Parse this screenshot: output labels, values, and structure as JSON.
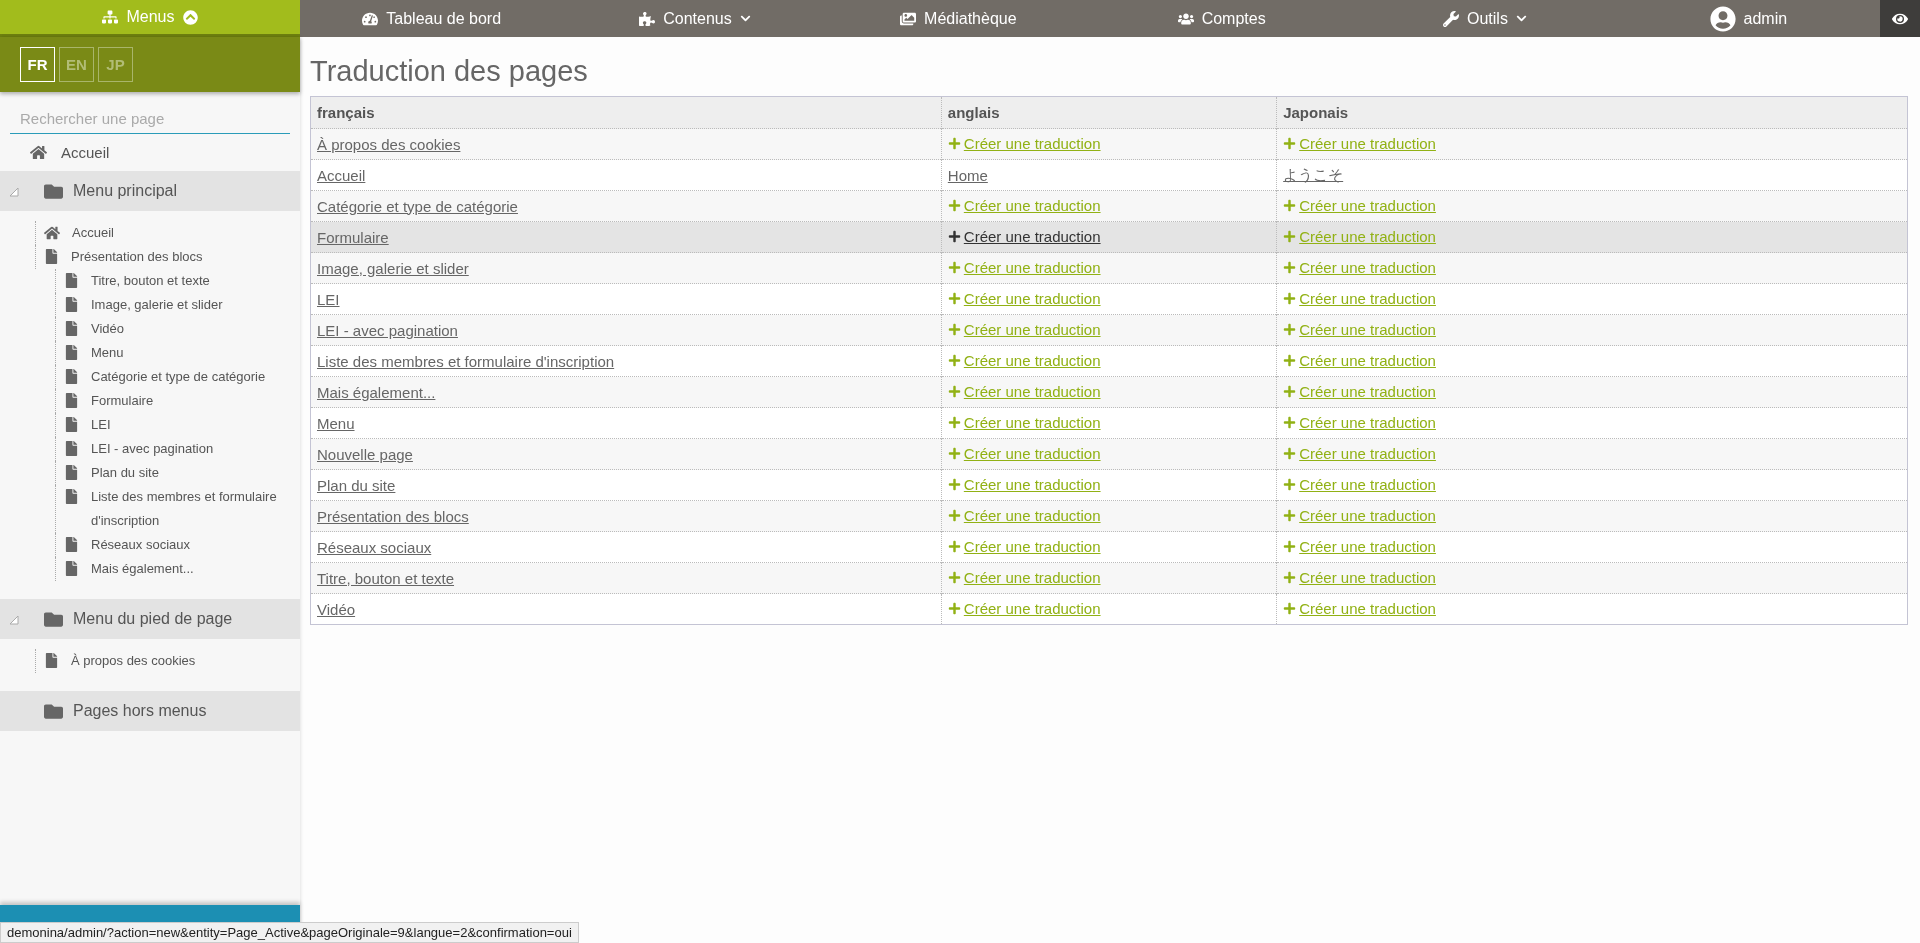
{
  "nav": {
    "items": [
      {
        "kind": "menus",
        "label": "Menus",
        "selected": true,
        "dropdown": true
      },
      {
        "kind": "dashboard",
        "label": "Tableau de bord",
        "selected": false,
        "dropdown": false
      },
      {
        "kind": "content",
        "label": "Contenus",
        "selected": false,
        "dropdown": true
      },
      {
        "kind": "media",
        "label": "Médiathèque",
        "selected": false,
        "dropdown": false
      },
      {
        "kind": "accounts",
        "label": "Comptes",
        "selected": false,
        "dropdown": false
      },
      {
        "kind": "tools",
        "label": "Outils",
        "selected": false,
        "dropdown": true
      },
      {
        "kind": "user",
        "label": "admin",
        "selected": false,
        "dropdown": false
      }
    ]
  },
  "sidebar": {
    "languages": [
      {
        "label": "FR",
        "selected": true
      },
      {
        "label": "EN",
        "selected": false
      },
      {
        "label": "JP",
        "selected": false
      }
    ],
    "search": {
      "placeholder": "Rechercher une page"
    },
    "home": {
      "label": "Accueil"
    },
    "groups": [
      {
        "label": "Menu principal",
        "expanded": true,
        "children": [
          {
            "kind": "home",
            "label": "Accueil"
          },
          {
            "kind": "page",
            "label": "Présentation des blocs",
            "children": [
              {
                "kind": "page",
                "label": "Titre, bouton et texte"
              },
              {
                "kind": "page",
                "label": "Image, galerie et slider"
              },
              {
                "kind": "page",
                "label": "Vidéo"
              },
              {
                "kind": "page",
                "label": "Menu"
              },
              {
                "kind": "page",
                "label": "Catégorie et type de catégorie"
              },
              {
                "kind": "page",
                "label": "Formulaire"
              },
              {
                "kind": "page",
                "label": "LEI"
              },
              {
                "kind": "page",
                "label": "LEI - avec pagination"
              },
              {
                "kind": "page",
                "label": "Plan du site"
              },
              {
                "kind": "page",
                "label": "Liste des membres et formulaire d'inscription"
              },
              {
                "kind": "page",
                "label": "Réseaux sociaux"
              },
              {
                "kind": "page",
                "label": "Mais également..."
              }
            ]
          }
        ]
      },
      {
        "label": "Menu du pied de page",
        "expanded": true,
        "children": [
          {
            "kind": "page",
            "label": "À propos des cookies"
          }
        ]
      },
      {
        "label": "Pages hors menus",
        "expanded": false
      }
    ]
  },
  "page": {
    "title": "Traduction des pages"
  },
  "table": {
    "columns": [
      "français",
      "anglais",
      "Japonais"
    ],
    "rows": [
      {
        "hovered": false,
        "cells": [
          {
            "kind": "link",
            "text": "À propos des cookies"
          },
          {
            "kind": "create",
            "text": "Créer une traduction",
            "hovered": false
          },
          {
            "kind": "create",
            "text": "Créer une traduction",
            "hovered": false
          }
        ]
      },
      {
        "hovered": false,
        "cells": [
          {
            "kind": "link",
            "text": "Accueil"
          },
          {
            "kind": "link",
            "text": "Home"
          },
          {
            "kind": "link",
            "text": "ようこそ"
          }
        ]
      },
      {
        "hovered": false,
        "cells": [
          {
            "kind": "link",
            "text": "Catégorie et type de catégorie"
          },
          {
            "kind": "create",
            "text": "Créer une traduction",
            "hovered": false
          },
          {
            "kind": "create",
            "text": "Créer une traduction",
            "hovered": false
          }
        ]
      },
      {
        "hovered": true,
        "cells": [
          {
            "kind": "link",
            "text": "Formulaire"
          },
          {
            "kind": "create",
            "text": "Créer une traduction",
            "hovered": true
          },
          {
            "kind": "create",
            "text": "Créer une traduction",
            "hovered": false
          }
        ]
      },
      {
        "hovered": false,
        "cells": [
          {
            "kind": "link",
            "text": "Image, galerie et slider"
          },
          {
            "kind": "create",
            "text": "Créer une traduction",
            "hovered": false
          },
          {
            "kind": "create",
            "text": "Créer une traduction",
            "hovered": false
          }
        ]
      },
      {
        "hovered": false,
        "cells": [
          {
            "kind": "link",
            "text": "LEI"
          },
          {
            "kind": "create",
            "text": "Créer une traduction",
            "hovered": false
          },
          {
            "kind": "create",
            "text": "Créer une traduction",
            "hovered": false
          }
        ]
      },
      {
        "hovered": false,
        "cells": [
          {
            "kind": "link",
            "text": "LEI - avec pagination"
          },
          {
            "kind": "create",
            "text": "Créer une traduction",
            "hovered": false
          },
          {
            "kind": "create",
            "text": "Créer une traduction",
            "hovered": false
          }
        ]
      },
      {
        "hovered": false,
        "cells": [
          {
            "kind": "link",
            "text": "Liste des membres et formulaire d'inscription"
          },
          {
            "kind": "create",
            "text": "Créer une traduction",
            "hovered": false
          },
          {
            "kind": "create",
            "text": "Créer une traduction",
            "hovered": false
          }
        ]
      },
      {
        "hovered": false,
        "cells": [
          {
            "kind": "link",
            "text": "Mais également..."
          },
          {
            "kind": "create",
            "text": "Créer une traduction",
            "hovered": false
          },
          {
            "kind": "create",
            "text": "Créer une traduction",
            "hovered": false
          }
        ]
      },
      {
        "hovered": false,
        "cells": [
          {
            "kind": "link",
            "text": "Menu"
          },
          {
            "kind": "create",
            "text": "Créer une traduction",
            "hovered": false
          },
          {
            "kind": "create",
            "text": "Créer une traduction",
            "hovered": false
          }
        ]
      },
      {
        "hovered": false,
        "cells": [
          {
            "kind": "link",
            "text": "Nouvelle page"
          },
          {
            "kind": "create",
            "text": "Créer une traduction",
            "hovered": false
          },
          {
            "kind": "create",
            "text": "Créer une traduction",
            "hovered": false
          }
        ]
      },
      {
        "hovered": false,
        "cells": [
          {
            "kind": "link",
            "text": "Plan du site"
          },
          {
            "kind": "create",
            "text": "Créer une traduction",
            "hovered": false
          },
          {
            "kind": "create",
            "text": "Créer une traduction",
            "hovered": false
          }
        ]
      },
      {
        "hovered": false,
        "cells": [
          {
            "kind": "link",
            "text": "Présentation des blocs"
          },
          {
            "kind": "create",
            "text": "Créer une traduction",
            "hovered": false
          },
          {
            "kind": "create",
            "text": "Créer une traduction",
            "hovered": false
          }
        ]
      },
      {
        "hovered": false,
        "cells": [
          {
            "kind": "link",
            "text": "Réseaux sociaux"
          },
          {
            "kind": "create",
            "text": "Créer une traduction",
            "hovered": false
          },
          {
            "kind": "create",
            "text": "Créer une traduction",
            "hovered": false
          }
        ]
      },
      {
        "hovered": false,
        "cells": [
          {
            "kind": "link",
            "text": "Titre, bouton et texte"
          },
          {
            "kind": "create",
            "text": "Créer une traduction",
            "hovered": false
          },
          {
            "kind": "create",
            "text": "Créer une traduction",
            "hovered": false
          }
        ]
      },
      {
        "hovered": false,
        "cells": [
          {
            "kind": "link",
            "text": "Vidéo"
          },
          {
            "kind": "create",
            "text": "Créer une traduction",
            "hovered": false
          },
          {
            "kind": "create",
            "text": "Créer une traduction",
            "hovered": false
          }
        ]
      }
    ]
  },
  "status_bar": {
    "url": "demonina/admin/?action=new&entity=Page_Active&pageOriginale=9&langue=2&confirmation=oui"
  }
}
